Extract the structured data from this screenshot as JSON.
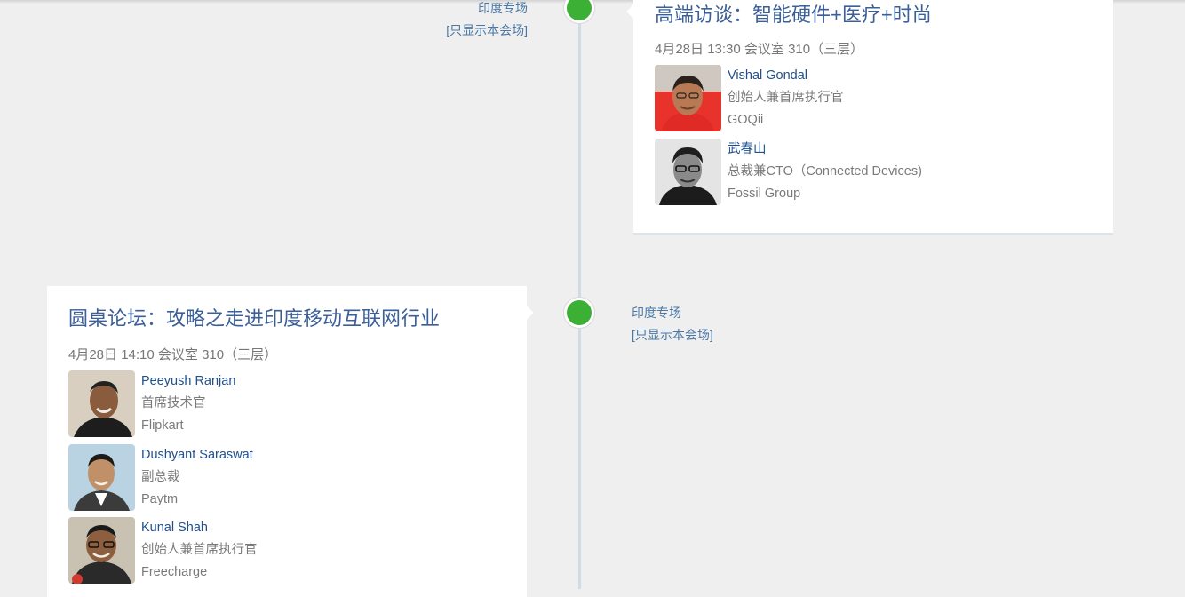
{
  "timeline": [
    {
      "track": "印度专场",
      "filter_link": "[只显示本会场]",
      "title": "高端访谈：智能硬件+医疗+时尚",
      "meta": "4月28日 13:30 会议室 310（三层）",
      "speakers": [
        {
          "name": "Vishal Gondal",
          "role": "创始人兼首席执行官",
          "org": "GOQii",
          "avatar_bg": "#e8322c",
          "avatar_skin": "#b77a55",
          "avatar_hair": "#2a211c"
        },
        {
          "name": "武春山",
          "role": "总裁兼CTO（Connected Devices)",
          "org": "Fossil Group",
          "avatar_bg": "#e4e4e4",
          "avatar_skin": "#6e6e6e",
          "avatar_hair": "#1e1e1e"
        }
      ]
    },
    {
      "track": "印度专场",
      "filter_link": "[只显示本会场]",
      "title": "圆桌论坛：攻略之走进印度移动互联网行业",
      "meta": "4月28日 14:10 会议室 310（三层）",
      "speakers": [
        {
          "name": "Peeyush Ranjan",
          "role": "首席技术官",
          "org": "Flipkart",
          "avatar_bg": "#d8cfc0",
          "avatar_skin": "#8a5c3e",
          "avatar_hair": "#222222"
        },
        {
          "name": "Dushyant Saraswat",
          "role": "副总裁",
          "org": "Paytm",
          "avatar_bg": "#b9d3e3",
          "avatar_skin": "#c09068",
          "avatar_hair": "#1e1a18"
        },
        {
          "name": "Kunal Shah",
          "role": "创始人兼首席执行官",
          "org": "Freecharge",
          "avatar_bg": "#c9c2b2",
          "avatar_skin": "#8d5f3f",
          "avatar_hair": "#1a1a1a"
        }
      ]
    }
  ],
  "colors": {
    "dot": "#3cb034",
    "line": "#cfdbe6",
    "title": "#3a5f99",
    "link": "#4a78a6"
  }
}
